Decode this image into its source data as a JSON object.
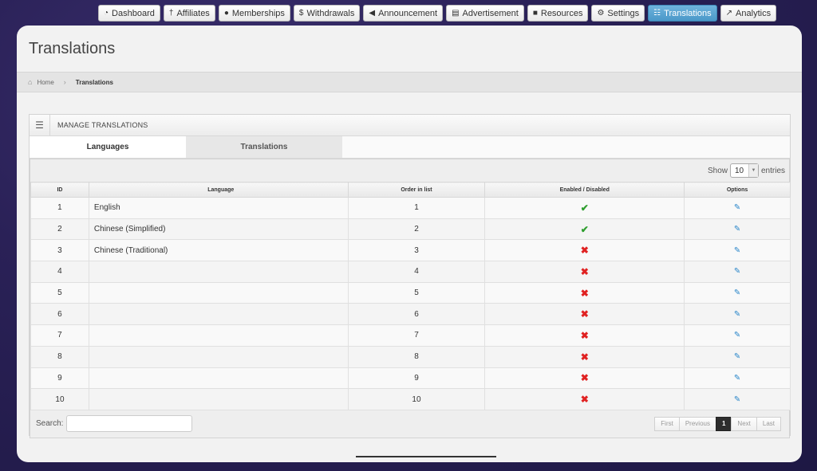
{
  "nav": [
    {
      "label": "Dashboard",
      "icon": "dashboard-icon",
      "glyph": "◔",
      "active": false
    },
    {
      "label": "Affiliates",
      "icon": "affiliate-icon",
      "glyph": "†",
      "active": false
    },
    {
      "label": "Memberships",
      "icon": "user-icon",
      "glyph": "●",
      "active": false
    },
    {
      "label": "Withdrawals",
      "icon": "dollar-icon",
      "glyph": "$",
      "active": false
    },
    {
      "label": "Announcement",
      "icon": "megaphone-icon",
      "glyph": "◀",
      "active": false
    },
    {
      "label": "Advertisement",
      "icon": "film-icon",
      "glyph": "▤",
      "active": false
    },
    {
      "label": "Resources",
      "icon": "file-icon",
      "glyph": "■",
      "active": false
    },
    {
      "label": "Settings",
      "icon": "gear-icon",
      "glyph": "⚙",
      "active": false
    },
    {
      "label": "Translations",
      "icon": "translate-icon",
      "glyph": "☷",
      "active": true
    },
    {
      "label": "Analytics",
      "icon": "chart-icon",
      "glyph": "↗",
      "active": false
    }
  ],
  "page": {
    "title": "Translations"
  },
  "breadcrumb": {
    "home": "Home",
    "current": "Translations"
  },
  "widget": {
    "title": "MANAGE TRANSLATIONS"
  },
  "tabs": [
    {
      "label": "Languages",
      "active": true
    },
    {
      "label": "Translations",
      "active": false
    }
  ],
  "table": {
    "show_label": "Show",
    "show_value": "10",
    "entries_label": "entries",
    "columns": [
      "ID",
      "Language",
      "Order in list",
      "Enabled / Disabled",
      "Options"
    ],
    "rows": [
      {
        "id": "1",
        "language": "English",
        "order": "1",
        "enabled": true
      },
      {
        "id": "2",
        "language": "Chinese (Simplified)",
        "order": "2",
        "enabled": true
      },
      {
        "id": "3",
        "language": "Chinese (Traditional)",
        "order": "3",
        "enabled": false
      },
      {
        "id": "4",
        "language": "",
        "order": "4",
        "enabled": false
      },
      {
        "id": "5",
        "language": "",
        "order": "5",
        "enabled": false
      },
      {
        "id": "6",
        "language": "",
        "order": "6",
        "enabled": false
      },
      {
        "id": "7",
        "language": "",
        "order": "7",
        "enabled": false
      },
      {
        "id": "8",
        "language": "",
        "order": "8",
        "enabled": false
      },
      {
        "id": "9",
        "language": "",
        "order": "9",
        "enabled": false
      },
      {
        "id": "10",
        "language": "",
        "order": "10",
        "enabled": false
      }
    ]
  },
  "search": {
    "label": "Search:",
    "value": ""
  },
  "pagination": {
    "first": "First",
    "previous": "Previous",
    "current": "1",
    "next": "Next",
    "last": "Last"
  },
  "colors": {
    "enabled": "#2e9e2e",
    "disabled": "#e02222",
    "active_tab": "#4a98c9",
    "edit": "#2a86c9"
  }
}
